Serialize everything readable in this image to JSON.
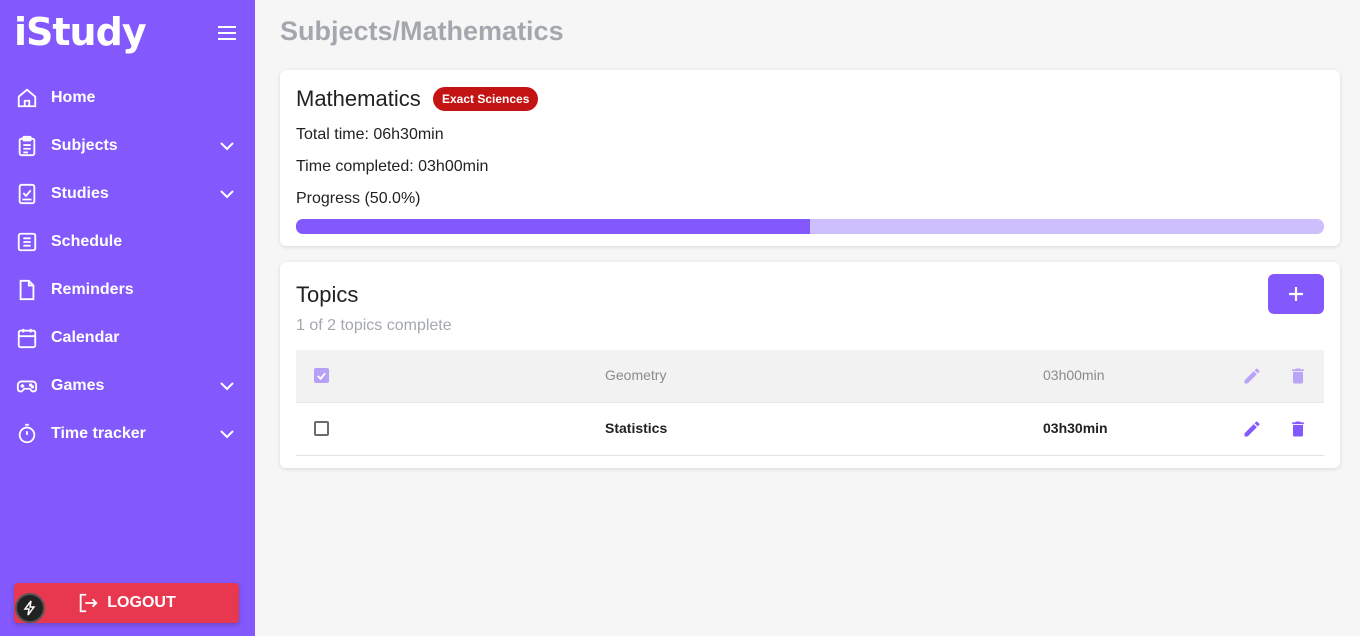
{
  "app": {
    "logo": "iStudy"
  },
  "colors": {
    "accent": "#8358fc",
    "accent_light": "#cdbffc",
    "danger": "#e8384f",
    "badge": "#c41313"
  },
  "sidebar": {
    "items": [
      {
        "label": "Home",
        "icon": "home-icon",
        "expandable": false
      },
      {
        "label": "Subjects",
        "icon": "clipboard-icon",
        "expandable": true
      },
      {
        "label": "Studies",
        "icon": "book-check-icon",
        "expandable": true
      },
      {
        "label": "Schedule",
        "icon": "list-icon",
        "expandable": false
      },
      {
        "label": "Reminders",
        "icon": "note-icon",
        "expandable": false
      },
      {
        "label": "Calendar",
        "icon": "calendar-icon",
        "expandable": false
      },
      {
        "label": "Games",
        "icon": "gamepad-icon",
        "expandable": true
      },
      {
        "label": "Time tracker",
        "icon": "timer-icon",
        "expandable": true
      }
    ],
    "logout_label": "LOGOUT"
  },
  "breadcrumb": "Subjects/Mathematics",
  "subject": {
    "name": "Mathematics",
    "badge": "Exact Sciences",
    "total_time": "Total time: 06h30min",
    "time_completed": "Time completed: 03h00min",
    "progress_label": "Progress (50.0%)",
    "progress": 0.5
  },
  "topics": {
    "title": "Topics",
    "summary": "1 of 2 topics complete",
    "rows": [
      {
        "name": "Geometry",
        "time": "03h00min",
        "completed": true
      },
      {
        "name": "Statistics",
        "time": "03h30min",
        "completed": false
      }
    ]
  }
}
